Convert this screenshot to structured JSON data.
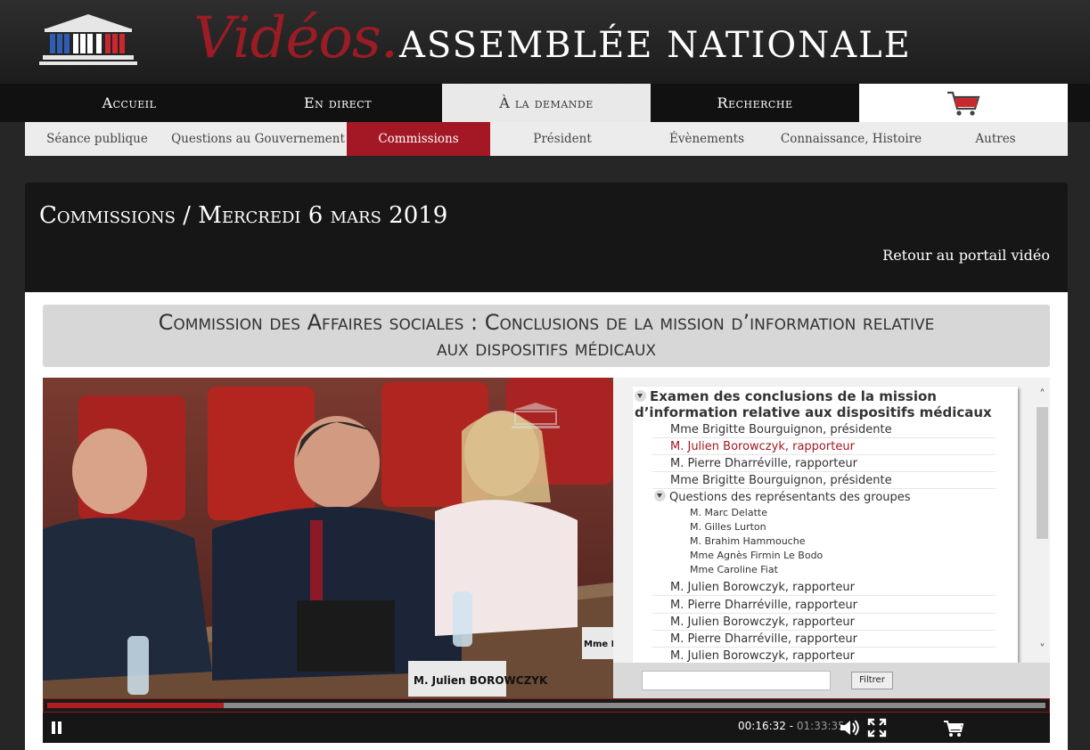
{
  "brand": {
    "videos": "Vidéos.",
    "assemblee": "ASSEMBLÉE NATIONALE"
  },
  "mainnav": [
    {
      "label": "Accueil"
    },
    {
      "label": "En direct"
    },
    {
      "label": "À la demande"
    },
    {
      "label": "Recherche"
    }
  ],
  "subnav": [
    {
      "label": "Séance publique"
    },
    {
      "label": "Questions au Gouvernement"
    },
    {
      "label": "Commissions"
    },
    {
      "label": "Président"
    },
    {
      "label": "Évènements"
    },
    {
      "label": "Connaissance, Histoire"
    },
    {
      "label": "Autres"
    }
  ],
  "page": {
    "title": "Commissions / Mercredi 6 mars 2019",
    "back_link": "Retour au portail vidéo",
    "session_title_line1": "Commission des Affaires sociales : Conclusions de la mission d’information relative",
    "session_title_line2": "aux dispositifs médicaux"
  },
  "chapters": {
    "heading_line1": "Examen des conclusions de la mission",
    "heading_line2": "d’information relative aux dispositifs médicaux",
    "rows_top": [
      "Mme Brigitte Bourguignon, présidente",
      "M. Julien Borowczyk, rapporteur",
      "M. Pierre Dharréville, rapporteur",
      "Mme Brigitte Bourguignon, présidente"
    ],
    "group_label": "Questions des représentants des groupes",
    "group_items": [
      "M. Marc Delatte",
      "M. Gilles Lurton",
      "M. Brahim Hammouche",
      "Mme Agnès Firmin Le Bodo",
      "Mme Caroline Fiat"
    ],
    "rows_bottom": [
      "M. Julien Borowczyk, rapporteur",
      "M. Pierre Dharréville, rapporteur",
      "M. Julien Borowczyk, rapporteur",
      "M. Pierre Dharréville, rapporteur",
      "M. Julien Borowczyk, rapporteur"
    ]
  },
  "filter": {
    "button": "Filtrer",
    "value": ""
  },
  "player": {
    "current_time": "00:16:32",
    "separator": " - ",
    "total_time": "01:33:35",
    "progress_fraction": 0.177
  },
  "video": {
    "nameplate": "M. Julien BOROWCZYK",
    "nameplate2": "Mme Brig"
  },
  "colors": {
    "accent": "#a31824",
    "brand_red": "#9b1c24",
    "highlight_text": "#a31824"
  },
  "icons": [
    "assemblee-logo-icon",
    "cart-icon",
    "pause-icon",
    "volume-icon",
    "fullscreen-icon",
    "triangle-down-icon"
  ]
}
